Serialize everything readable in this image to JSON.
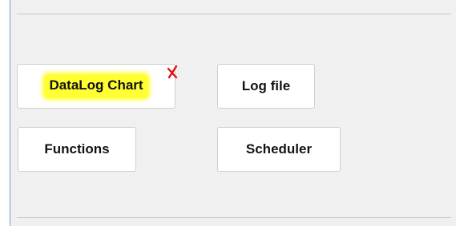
{
  "buttons": {
    "datalog_chart": "DataLog Chart",
    "log_file": "Log file",
    "functions": "Functions",
    "scheduler": "Scheduler"
  },
  "colors": {
    "highlight": "#ffff33",
    "remove_mark": "#e01010",
    "panel_background": "#f0f0f0",
    "panel_border": "#7a9cc8"
  },
  "icons": {
    "remove_mark": "red-x-icon"
  }
}
